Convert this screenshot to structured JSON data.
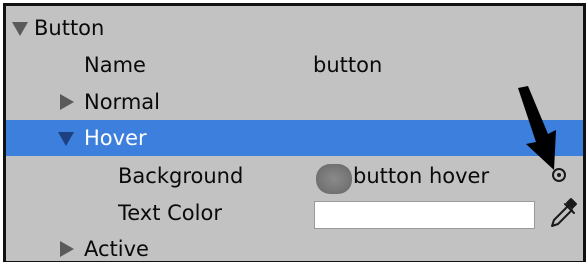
{
  "section": {
    "title": "Button"
  },
  "fields": {
    "name_label": "Name",
    "name_value": "button"
  },
  "states": {
    "normal_label": "Normal",
    "hover_label": "Hover",
    "active_label": "Active"
  },
  "hover": {
    "background_label": "Background",
    "background_value": "button hover",
    "text_color_label": "Text Color",
    "text_color_value": "#ffffff"
  },
  "icons": {
    "expanded": "triangle-down-icon",
    "collapsed": "triangle-right-icon",
    "object_picker": "object-picker-icon",
    "eyedropper": "eyedropper-icon",
    "annotation": "arrow-annotation-icon"
  },
  "colors": {
    "panel_bg": "#c2c2c2",
    "selection": "#3d7fdd",
    "text": "#0a0a0a"
  }
}
